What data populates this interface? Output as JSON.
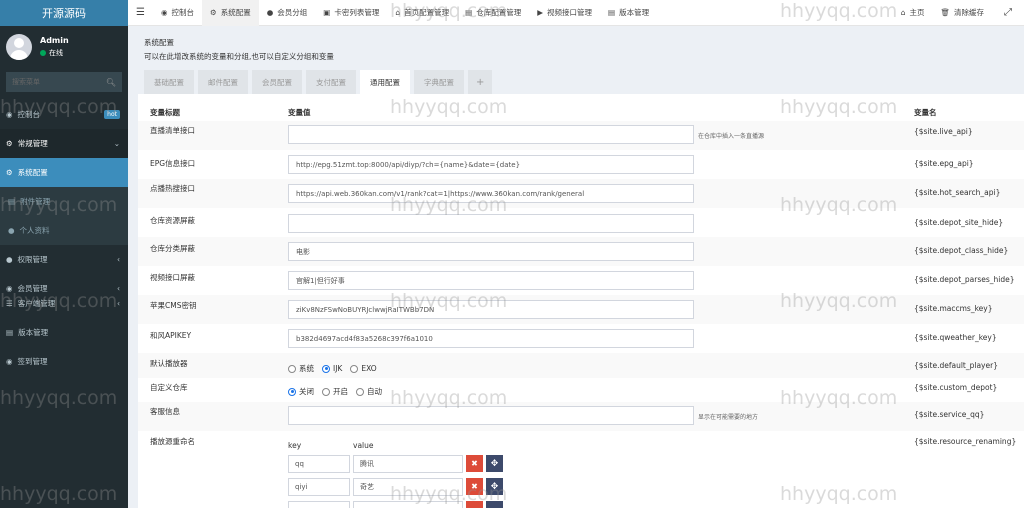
{
  "logo": "开源源码",
  "user": {
    "name": "Admin",
    "status": "在线"
  },
  "sidebar": {
    "search_placeholder": "搜索菜单",
    "items": [
      {
        "label": "控制台",
        "badge": "hot"
      },
      {
        "label": "常规管理"
      },
      {
        "label": "系统配置"
      },
      {
        "label": "附件管理"
      },
      {
        "label": "个人资料"
      },
      {
        "label": "权限管理"
      },
      {
        "label": "会员管理"
      },
      {
        "label": "客户端管理"
      },
      {
        "label": "版本管理"
      },
      {
        "label": "签到管理"
      }
    ]
  },
  "topnav": {
    "items": [
      "控制台",
      "系统配置",
      "会员分组",
      "卡密列表管理",
      "首页配置管理",
      "仓库配置管理",
      "视频接口管理",
      "版本管理"
    ],
    "home": "主页",
    "clear_cache": "清除缓存"
  },
  "page": {
    "title": "系统配置",
    "description": "可以在此增改系统的变量和分组,也可以自定义分组和变量"
  },
  "tabs": [
    "基础配置",
    "邮件配置",
    "会员配置",
    "支付配置",
    "通用配置",
    "字典配置",
    "+"
  ],
  "table": {
    "headers": {
      "title": "变量标题",
      "value": "变量值",
      "name": "变量名"
    },
    "rows": [
      {
        "title": "直播清单接口",
        "value": "",
        "hint": "在仓库中插入一条直播源",
        "name": "{$site.live_api}"
      },
      {
        "title": "EPG信息接口",
        "value": "http://epg.51zmt.top:8000/api/diyp/?ch={name}&date={date}",
        "name": "{$site.epg_api}"
      },
      {
        "title": "点播热搜接口",
        "value": "https://api.web.360kan.com/v1/rank?cat=1|https://www.360kan.com/rank/general",
        "name": "{$site.hot_search_api}"
      },
      {
        "title": "仓库资源屏蔽",
        "value": "",
        "name": "{$site.depot_site_hide}"
      },
      {
        "title": "仓库分类屏蔽",
        "value": "电影",
        "name": "{$site.depot_class_hide}"
      },
      {
        "title": "视频接口屏蔽",
        "value": "官解1|但行好事",
        "name": "{$site.depot_parses_hide}"
      },
      {
        "title": "苹果CMS密钥",
        "value": "ziKv8NzFSwNoBUYRJclwwjRaITWBb7DN",
        "name": "{$site.maccms_key}"
      },
      {
        "title": "和风APIKEY",
        "value": "b382d4697acd4f83a5268c397f6a1010",
        "name": "{$site.qweather_key}"
      },
      {
        "title": "默认播放器",
        "options": [
          "系统",
          "IJK",
          "EXO"
        ],
        "selected": "IJK",
        "name": "{$site.default_player}"
      },
      {
        "title": "自定义仓库",
        "options": [
          "关闭",
          "开启",
          "自动"
        ],
        "selected": "关闭",
        "name": "{$site.custom_depot}"
      },
      {
        "title": "客服信息",
        "value": "",
        "hint": "显示在可能需要的地方",
        "name": "{$site.service_qq}"
      },
      {
        "title": "播放源重命名",
        "name": "{$site.resource_renaming}"
      }
    ],
    "kv": {
      "key_label": "key",
      "value_label": "value",
      "rows": [
        {
          "key": "qq",
          "value": "腾讯"
        },
        {
          "key": "qiyi",
          "value": "奇艺"
        }
      ]
    }
  },
  "watermark": "hhyyqq.com"
}
